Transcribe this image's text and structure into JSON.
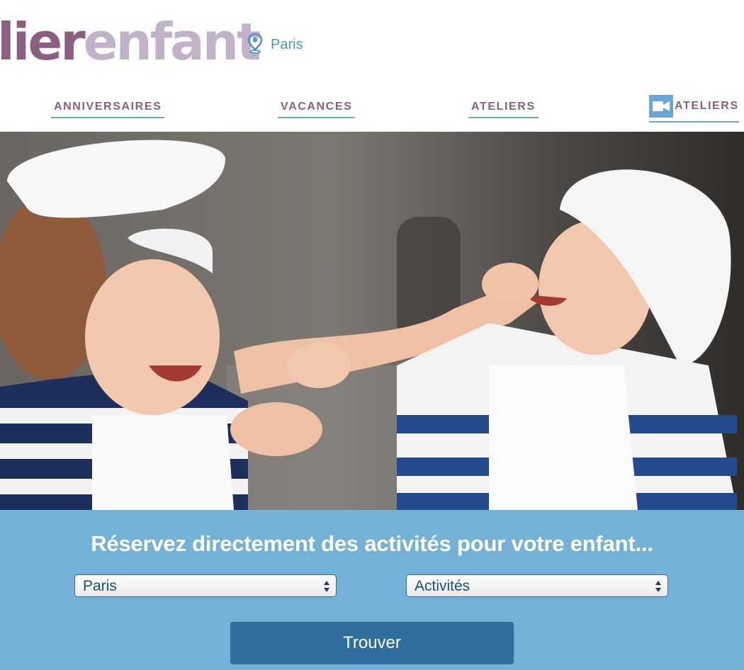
{
  "header": {
    "logo_part1": "lier",
    "logo_part2": "enfant",
    "location": "Paris",
    "location_icon": "map-pin-icon",
    "colors": {
      "logo_dark": "#8a5f83",
      "logo_light": "#c2b2c9",
      "accent_blue": "#4e93c7"
    }
  },
  "nav": {
    "items": [
      {
        "label": "ANNIVERSAIRES"
      },
      {
        "label": "VACANCES"
      },
      {
        "label": "ATELIERS"
      },
      {
        "label": "ATELIERS",
        "icon": "video-camera-icon"
      }
    ]
  },
  "hero": {
    "image": "children-cooking-photo"
  },
  "search": {
    "tagline": "Réservez directement des activités pour votre enfant...",
    "city_select": {
      "value": "Paris"
    },
    "activity_select": {
      "value": "Activités"
    },
    "submit_label": "Trouver",
    "colors": {
      "panel": "#73b1d6",
      "button": "#2f6d9c"
    }
  }
}
